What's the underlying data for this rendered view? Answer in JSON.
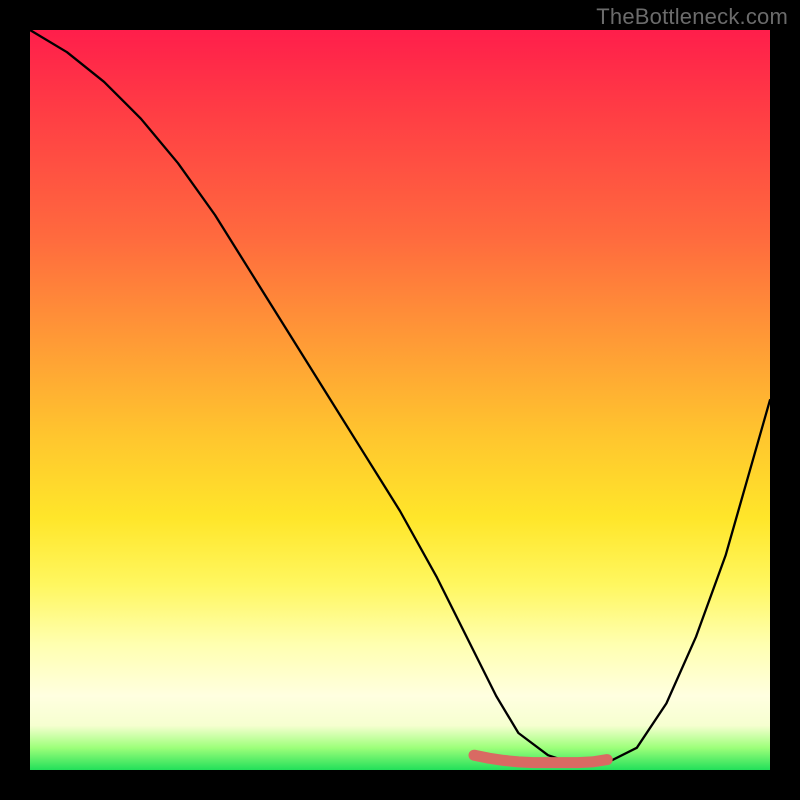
{
  "watermark": "TheBottleneck.com",
  "chart_data": {
    "type": "line",
    "title": "",
    "xlabel": "",
    "ylabel": "",
    "xlim": [
      0,
      100
    ],
    "ylim": [
      0,
      100
    ],
    "series": [
      {
        "name": "curve",
        "x": [
          0,
          5,
          10,
          15,
          20,
          25,
          30,
          35,
          40,
          45,
          50,
          55,
          60,
          63,
          66,
          70,
          73,
          75,
          78,
          82,
          86,
          90,
          94,
          100
        ],
        "values": [
          100,
          97,
          93,
          88,
          82,
          75,
          67,
          59,
          51,
          43,
          35,
          26,
          16,
          10,
          5,
          2,
          1,
          1,
          1,
          3,
          9,
          18,
          29,
          50
        ]
      },
      {
        "name": "red-marker",
        "x": [
          60,
          62,
          64,
          66,
          68,
          70,
          72,
          74,
          76,
          78
        ],
        "values": [
          2,
          1.6,
          1.3,
          1.1,
          1.0,
          1.0,
          1.0,
          1.0,
          1.1,
          1.4
        ]
      }
    ],
    "colors": {
      "curve": "#000000",
      "red_marker": "#d96a63",
      "gradient_top": "#ff1e4b",
      "gradient_bottom": "#22e05a"
    }
  }
}
